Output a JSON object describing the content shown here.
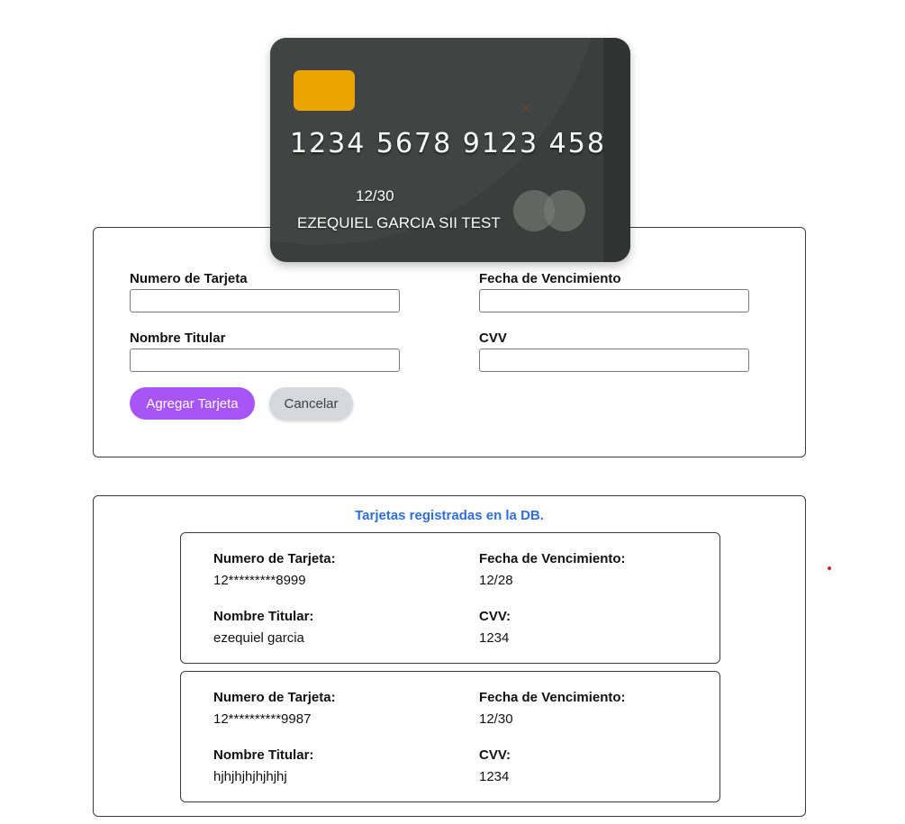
{
  "card_preview": {
    "number": "1234 5678 9123 458",
    "expiry": "12/30",
    "holder": "EZEQUIEL GARCIA SII TEST"
  },
  "form": {
    "card_number_label": "Numero de Tarjeta",
    "card_number_value": "",
    "expiry_label": "Fecha de Vencimiento",
    "expiry_value": "",
    "holder_label": "Nombre Titular",
    "holder_value": "",
    "cvv_label": "CVV",
    "cvv_value": "",
    "submit_label": "Agregar Tarjeta",
    "cancel_label": "Cancelar"
  },
  "records": {
    "title": "Tarjetas registradas en la DB.",
    "items": [
      {
        "number_label": "Numero de Tarjeta:",
        "number": "12*********8999",
        "expiry_label": "Fecha de Vencimiento:",
        "expiry": "12/28",
        "holder_label": "Nombre Titular:",
        "holder": "ezequiel garcia",
        "cvv_label": "CVV:",
        "cvv": "1234"
      },
      {
        "number_label": "Numero de Tarjeta:",
        "number": "12**********9987",
        "expiry_label": "Fecha de Vencimiento:",
        "expiry": "12/30",
        "holder_label": "Nombre Titular:",
        "holder": "hjhjhjhjhjhjhj",
        "cvv_label": "CVV:",
        "cvv": "1234"
      }
    ]
  },
  "colors": {
    "accent_button": "#a855f7",
    "list_title": "#2f6fd6",
    "card_body": "#3b3e3c",
    "chip": "#eba500"
  }
}
